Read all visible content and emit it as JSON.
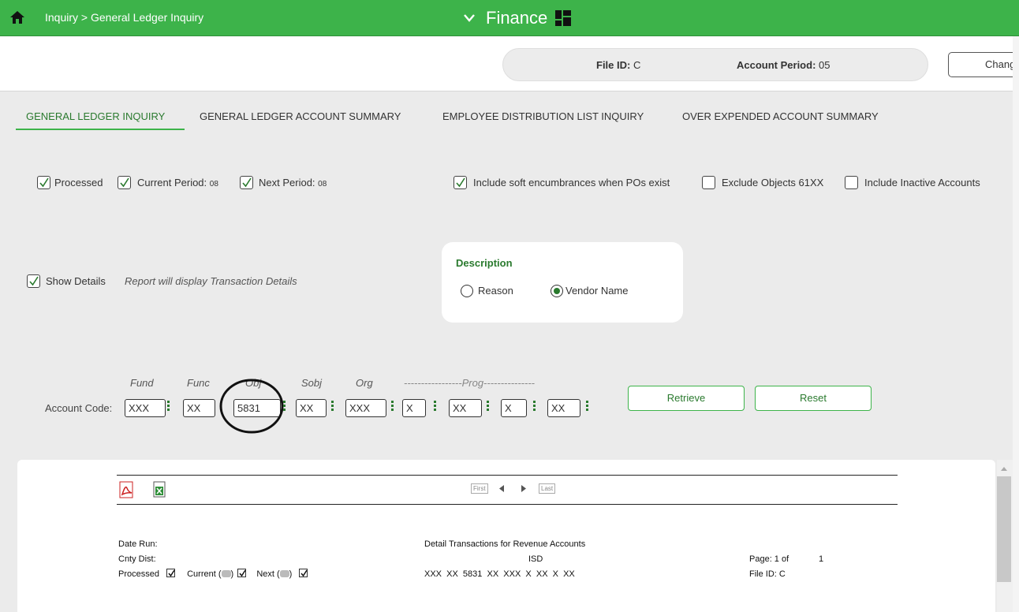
{
  "topbar": {
    "breadcrumb": "Inquiry > General Ledger Inquiry",
    "module": "Finance",
    "bg_color": "#3db34a"
  },
  "header": {
    "file_id_label": "File ID:",
    "file_id_value": "C",
    "account_period_label": "Account Period:",
    "account_period_value": "05",
    "change_button": "Change"
  },
  "tabs": [
    {
      "label": "GENERAL LEDGER INQUIRY",
      "active": true
    },
    {
      "label": "GENERAL LEDGER ACCOUNT SUMMARY",
      "active": false
    },
    {
      "label": "EMPLOYEE DISTRIBUTION LIST INQUIRY",
      "active": false
    },
    {
      "label": "OVER EXPENDED ACCOUNT SUMMARY",
      "active": false
    }
  ],
  "options": {
    "processed": {
      "label": "Processed",
      "checked": true
    },
    "current_period": {
      "label": "Current Period:",
      "value": "08",
      "checked": true
    },
    "next_period": {
      "label": "Next Period:",
      "value": "08",
      "checked": true
    },
    "soft_enc": {
      "label": "Include soft encumbrances when POs exist",
      "checked": true
    },
    "exclude_61xx": {
      "label": "Exclude Objects 61XX",
      "checked": false
    },
    "inactive": {
      "label": "Include Inactive Accounts",
      "checked": false
    },
    "show_details": {
      "label": "Show Details",
      "checked": true,
      "note": "Report will display Transaction Details"
    }
  },
  "description": {
    "title": "Description",
    "reason": "Reason",
    "vendor": "Vendor Name",
    "selected": "vendor"
  },
  "account_code": {
    "label": "Account Code:",
    "headers": {
      "fund": "Fund",
      "func": "Func",
      "obj": "Obj",
      "sobj": "Sobj",
      "org": "Org",
      "prog": "-----------------Prog---------------"
    },
    "fields": [
      "XXX",
      "XX",
      "5831",
      "XX",
      "XXX",
      "X",
      "XX",
      "X",
      "XX"
    ],
    "retrieve": "Retrieve",
    "reset": "Reset"
  },
  "report": {
    "pager": {
      "first": "First",
      "last": "Last"
    },
    "date_run": "Date Run:",
    "cnty_dist": "Cnty Dist:",
    "processed": "Processed",
    "current": "Current (",
    "next": "Next (",
    "title": "Detail Transactions for Revenue Accounts",
    "isd": "ISD",
    "account_line": "XXX  XX  5831  XX  XXX  X  XX  X  XX",
    "page_label": "Page: 1 of",
    "page_total": "1",
    "file_id": "File ID: C"
  }
}
